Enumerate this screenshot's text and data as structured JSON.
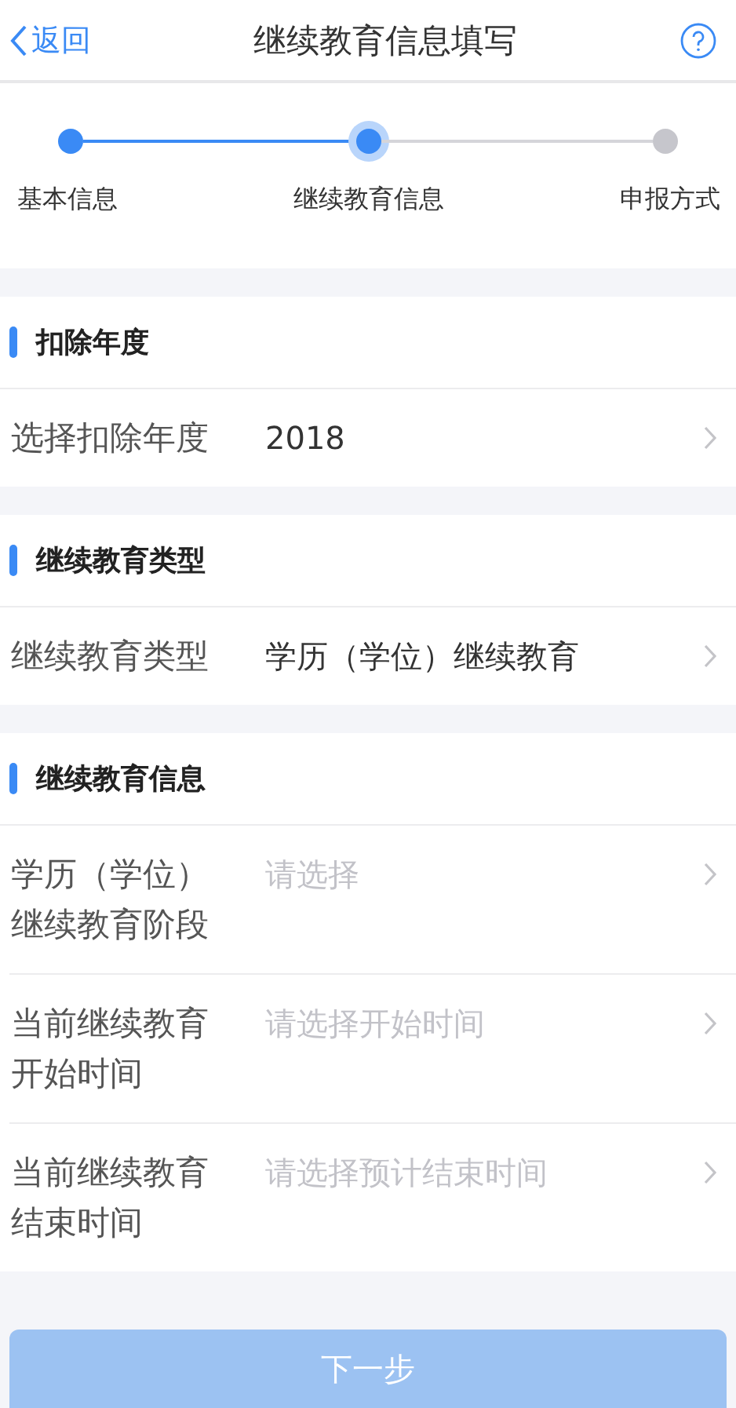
{
  "nav": {
    "back": "返回",
    "title": "继续教育信息填写"
  },
  "steps": [
    {
      "label": "基本信息",
      "done": true,
      "selected": false
    },
    {
      "label": "继续教育信息",
      "done": false,
      "selected": true
    },
    {
      "label": "申报方式",
      "done": false,
      "selected": false
    }
  ],
  "sections": [
    {
      "title": "扣除年度",
      "rows": [
        {
          "label": "选择扣除年度",
          "value": "2018"
        }
      ]
    },
    {
      "title": "继续教育类型",
      "rows": [
        {
          "label": "继续教育类型",
          "value": "学历（学位）继续教育"
        }
      ]
    },
    {
      "title": "继续教育信息",
      "rows": [
        {
          "label": "学历（学位）继续教育阶段",
          "placeholder": "请选择"
        },
        {
          "label": "当前继续教育开始时间",
          "placeholder": "请选择开始时间"
        },
        {
          "label": "当前继续教育结束时间",
          "placeholder": "请选择预计结束时间"
        }
      ]
    }
  ],
  "next_button": {
    "label": "下一步",
    "disabled": true
  }
}
